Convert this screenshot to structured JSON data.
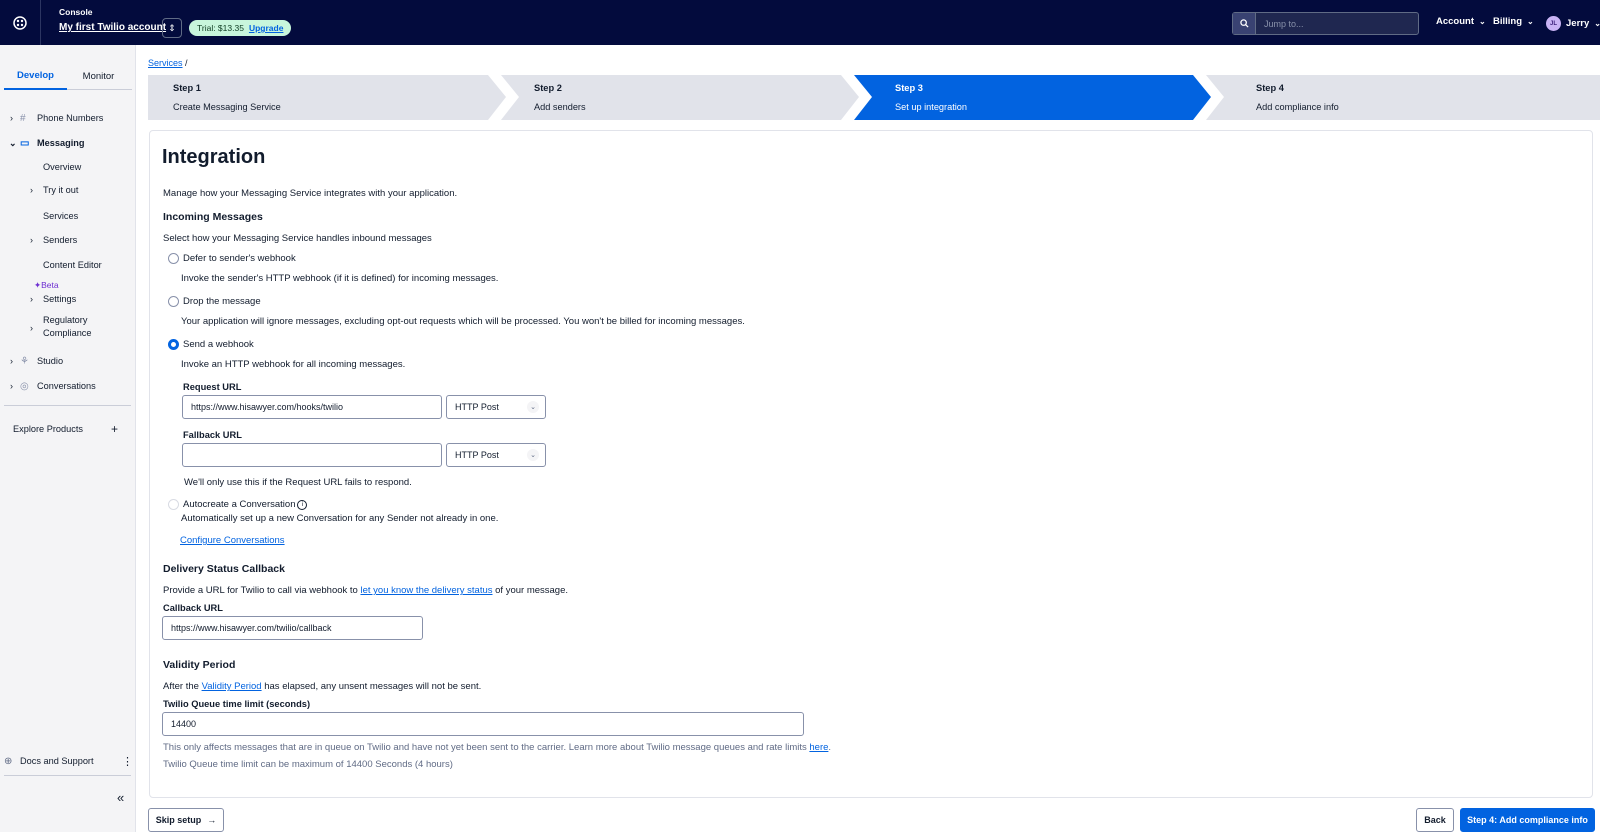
{
  "topbar": {
    "console_label": "Console",
    "account_name": "My first Twilio account",
    "trial_text": "Trial: $13.35",
    "upgrade_label": "Upgrade",
    "search_placeholder": "Jump to...",
    "account_menu": "Account",
    "billing_menu": "Billing",
    "user_initials": "JL",
    "user_name": "Jerry"
  },
  "sidebar": {
    "tabs": [
      "Develop",
      "Monitor"
    ],
    "items": {
      "phone_numbers": "Phone Numbers",
      "messaging": "Messaging",
      "overview": "Overview",
      "try_it_out": "Try it out",
      "services": "Services",
      "senders": "Senders",
      "content_editor": "Content Editor",
      "beta": "Beta",
      "settings": "Settings",
      "regulatory_1": "Regulatory",
      "regulatory_2": "Compliance",
      "studio": "Studio",
      "conversations": "Conversations"
    },
    "explore_products": "Explore Products",
    "docs_support": "Docs and Support"
  },
  "breadcrumb": {
    "services": "Services",
    "sep": "/"
  },
  "steps": [
    {
      "title": "Step 1",
      "subtitle": "Create Messaging Service"
    },
    {
      "title": "Step 2",
      "subtitle": "Add senders"
    },
    {
      "title": "Step 3",
      "subtitle": "Set up integration"
    },
    {
      "title": "Step 4",
      "subtitle": "Add compliance info"
    }
  ],
  "integration": {
    "title": "Integration",
    "description": "Manage how your Messaging Service integrates with your application.",
    "incoming_heading": "Incoming Messages",
    "incoming_desc": "Select how your Messaging Service handles inbound messages",
    "options": {
      "defer_label": "Defer to sender's webhook",
      "defer_desc": "Invoke the sender's HTTP webhook (if it is defined) for incoming messages.",
      "drop_label": "Drop the message",
      "drop_desc": "Your application will ignore messages, excluding opt-out requests which will be processed. You won't be billed for incoming messages.",
      "webhook_label": "Send a webhook",
      "webhook_desc": "Invoke an HTTP webhook for all incoming messages."
    },
    "request_url_label": "Request URL",
    "request_url_value": "https://www.hisawyer.com/hooks/twilio",
    "request_method": "HTTP Post",
    "fallback_url_label": "Fallback URL",
    "fallback_url_value": "",
    "fallback_method": "HTTP Post",
    "fallback_help": "We'll only use this if the Request URL fails to respond.",
    "autocreate_label": "Autocreate a Conversation",
    "autocreate_desc": "Automatically set up a new Conversation for any Sender not already in one.",
    "configure_conversations": "Configure Conversations",
    "delivery_heading": "Delivery Status Callback",
    "delivery_desc_pre": "Provide a URL for Twilio to call via webhook to",
    "delivery_link": "let you know the delivery status",
    "delivery_desc_post": "of your message.",
    "callback_label": "Callback URL",
    "callback_value": "https://www.hisawyer.com/twilio/callback",
    "validity_heading": "Validity Period",
    "validity_pre": "After the",
    "validity_link": "Validity Period",
    "validity_post": "has elapsed, any unsent messages will not be sent.",
    "queue_label": "Twilio Queue time limit (seconds)",
    "queue_value": "14400",
    "queue_help_pre": "This only affects messages that are in queue on Twilio and have not yet been sent to the carrier. Learn more about Twilio message queues and rate limits",
    "queue_help_link": "here",
    "queue_max": "Twilio Queue time limit can be maximum of 14400 Seconds (4 hours)"
  },
  "footer": {
    "skip_setup": "Skip setup",
    "back": "Back",
    "next": "Step 4: Add compliance info"
  },
  "colors": {
    "topbar": "#030b3d",
    "primary": "#0263e0",
    "step_inactive": "#e1e3ea"
  }
}
